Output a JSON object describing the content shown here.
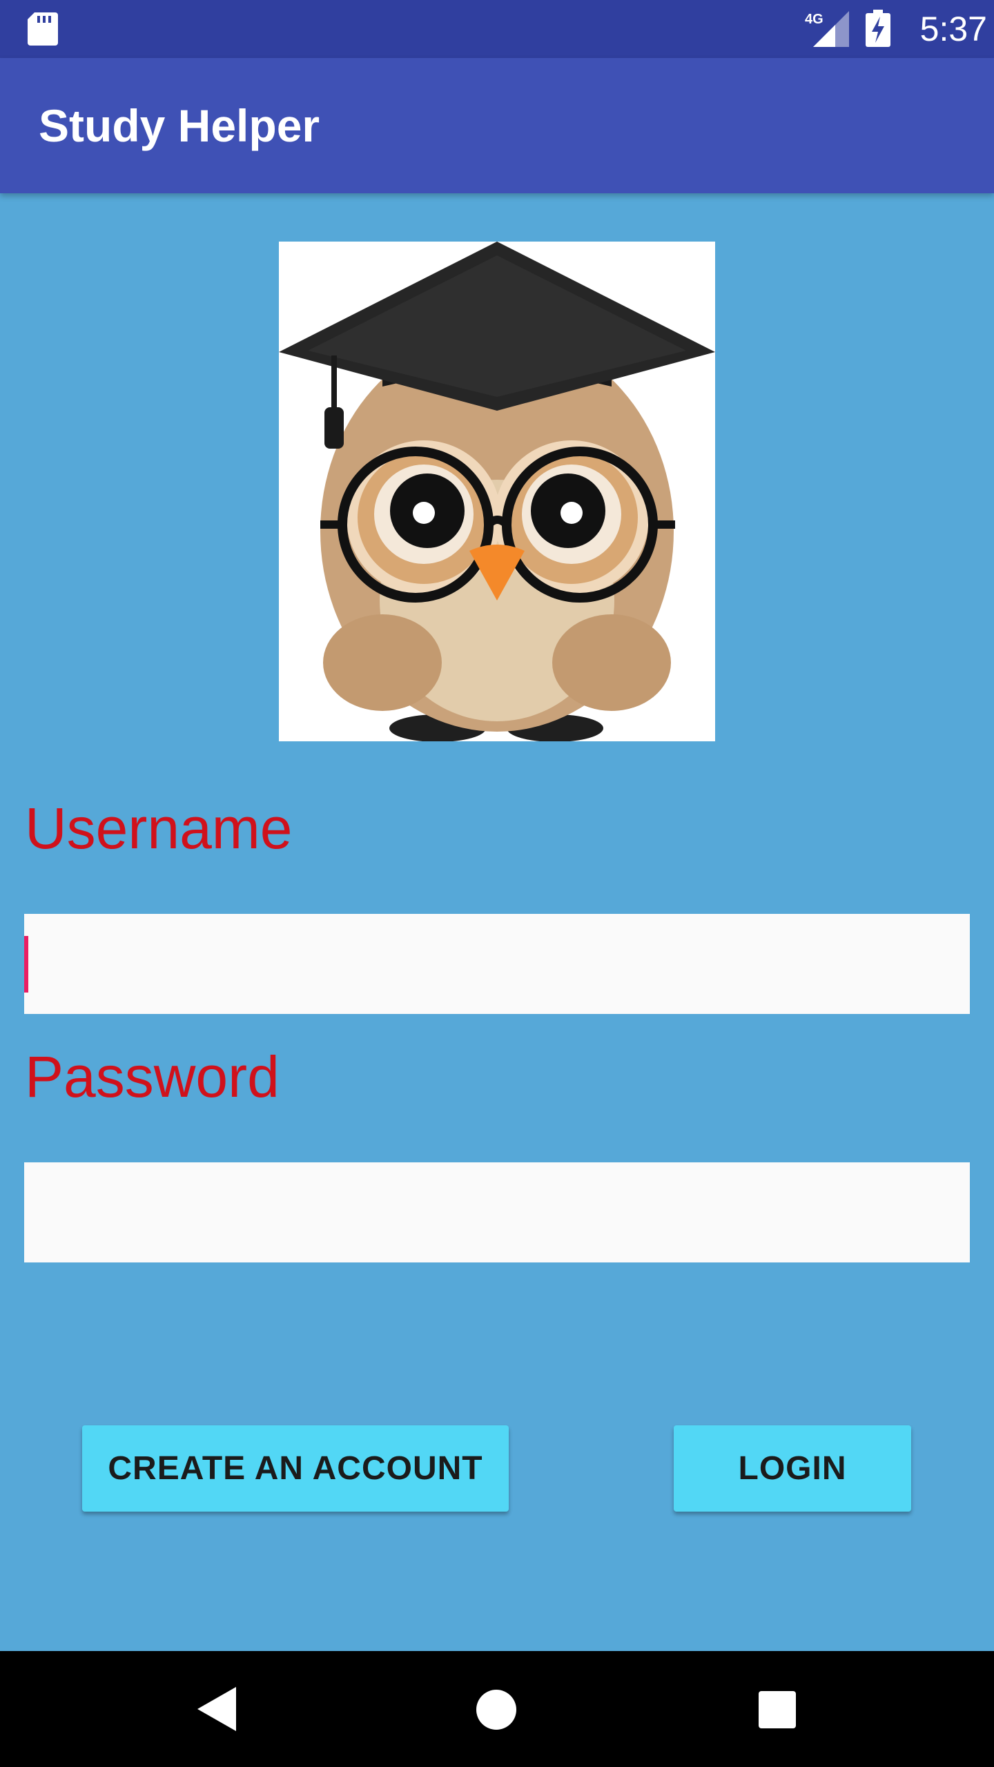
{
  "status_bar": {
    "time": "5:37",
    "network": "4G",
    "icons": [
      "sd-card-icon",
      "signal-4g-icon",
      "battery-charging-icon"
    ]
  },
  "app_bar": {
    "title": "Study Helper"
  },
  "logo": {
    "icon": "graduation-owl-icon"
  },
  "form": {
    "username_label": "Username",
    "username_value": "",
    "password_label": "Password",
    "password_value": ""
  },
  "buttons": {
    "create_account": "CREATE AN ACCOUNT",
    "login": "LOGIN"
  },
  "nav_bar": {
    "icons": [
      "back-icon",
      "home-icon",
      "recents-icon"
    ]
  },
  "colors": {
    "status_bar": "#303f9f",
    "app_bar": "#3f51b5",
    "background": "#56a8d8",
    "label_text": "#d0111b",
    "button": "#52d7f5",
    "cursor": "#e91e63"
  }
}
